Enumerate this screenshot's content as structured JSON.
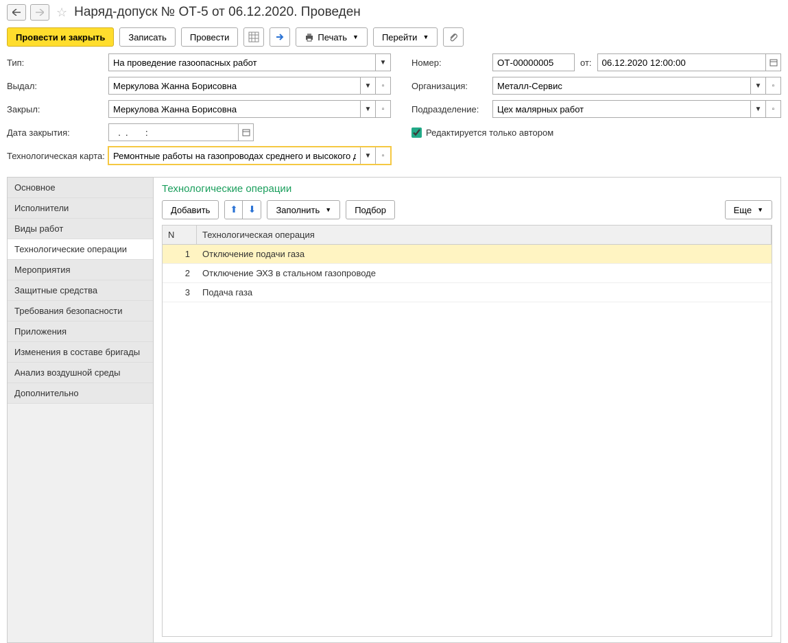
{
  "page_title": "Наряд-допуск № ОТ-5 от 06.12.2020. Проведен",
  "toolbar": {
    "post_close": "Провести и закрыть",
    "save": "Записать",
    "post": "Провести",
    "print": "Печать",
    "goto": "Перейти"
  },
  "form": {
    "type_label": "Тип:",
    "type_value": "На проведение газоопасных работ",
    "issued_label": "Выдал:",
    "issued_value": "Меркулова Жанна Борисовна",
    "closed_label": "Закрыл:",
    "closed_value": "Меркулова Жанна Борисовна",
    "close_date_label": "Дата закрытия:",
    "close_date_value": "  .  .       :  ",
    "techcard_label": "Технологическая карта:",
    "techcard_value": "Ремонтные работы на газопроводах среднего и высокого да",
    "number_label": "Номер:",
    "number_value": "ОТ-00000005",
    "from_label": "от:",
    "date_value": "06.12.2020 12:00:00",
    "org_label": "Организация:",
    "org_value": "Металл-Сервис",
    "dept_label": "Подразделение:",
    "dept_value": "Цех малярных работ",
    "edit_author_only": "Редактируется только автором"
  },
  "sidebar": {
    "items": [
      "Основное",
      "Исполнители",
      "Виды работ",
      "Технологические операции",
      "Мероприятия",
      "Защитные средства",
      "Требования безопасности",
      "Приложения",
      "Изменения в составе бригады",
      "Анализ воздушной среды",
      "Дополнительно"
    ],
    "active_index": 3
  },
  "content": {
    "title": "Технологические операции",
    "add": "Добавить",
    "fill": "Заполнить",
    "pick": "Подбор",
    "more": "Еще",
    "col_n": "N",
    "col_op": "Технологическая операция",
    "rows": [
      {
        "n": "1",
        "op": "Отключение подачи газа"
      },
      {
        "n": "2",
        "op": "Отключение ЭХЗ в стальном газопроводе"
      },
      {
        "n": "3",
        "op": "Подача газа"
      }
    ],
    "selected_index": 0
  }
}
